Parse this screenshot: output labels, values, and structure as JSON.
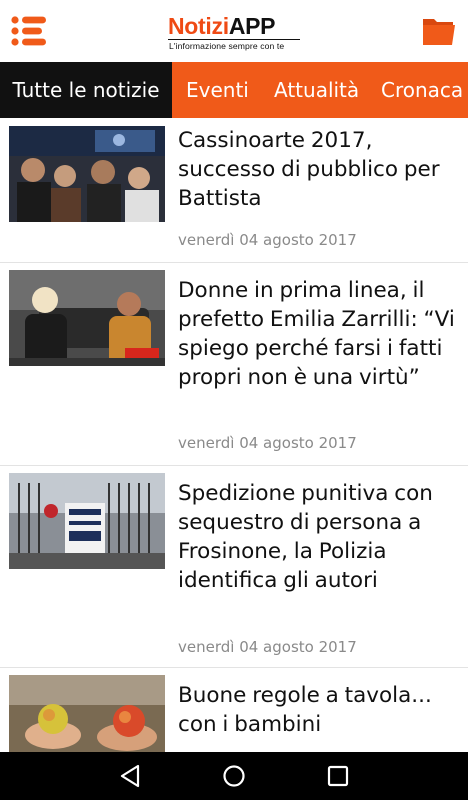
{
  "app": {
    "logo_main": "Notizi",
    "logo_app": "APP",
    "logo_tagline": "L'informazione sempre con te",
    "accent_color": "#f05a19"
  },
  "header": {
    "menu_icon": "hamburger-menu-icon",
    "folder_icon": "folder-icon"
  },
  "tabs": [
    {
      "label": "Tutte le notizie",
      "active": true
    },
    {
      "label": "Eventi",
      "active": false
    },
    {
      "label": "Attualità",
      "active": false
    },
    {
      "label": "Cronaca",
      "active": false
    }
  ],
  "articles": [
    {
      "title": "Cassinoarte 2017, successo di pubblico per Battista",
      "date": "venerdì 04 agosto 2017",
      "image": "crowd-at-night-event-photo"
    },
    {
      "title": "Donne in prima linea, il prefetto Emilia Zarrilli: “Vi spiego perché farsi i fatti propri non è una virtù”",
      "date": "venerdì 04 agosto 2017",
      "image": "interview-two-women-photo"
    },
    {
      "title": "Spedizione punitiva con sequestro di persona a Frosinone, la Polizia identifica gli autori",
      "date": "venerdì 04 agosto 2017",
      "image": "questura-police-gate-photo"
    },
    {
      "title": "Buone regole a tavola... con i bambini",
      "date": "",
      "image": "child-hands-apples-photo"
    }
  ],
  "system_nav": {
    "back_icon": "back-triangle-icon",
    "home_icon": "home-circle-icon",
    "recents_icon": "recents-square-icon"
  }
}
